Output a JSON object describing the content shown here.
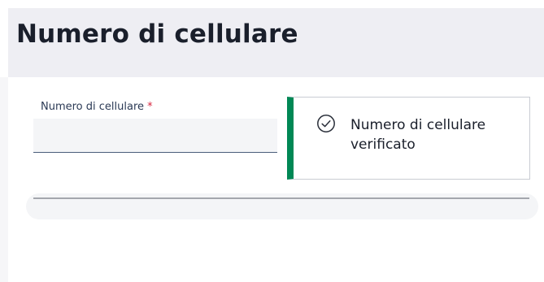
{
  "header": {
    "title": "Numero di cellulare"
  },
  "form": {
    "phone_label": "Numero di cellulare",
    "required_marker": "*",
    "phone_value": ""
  },
  "notice": {
    "icon": "check-circle-icon",
    "message": "Numero di cellulare verificato",
    "accent_color": "#008855"
  }
}
